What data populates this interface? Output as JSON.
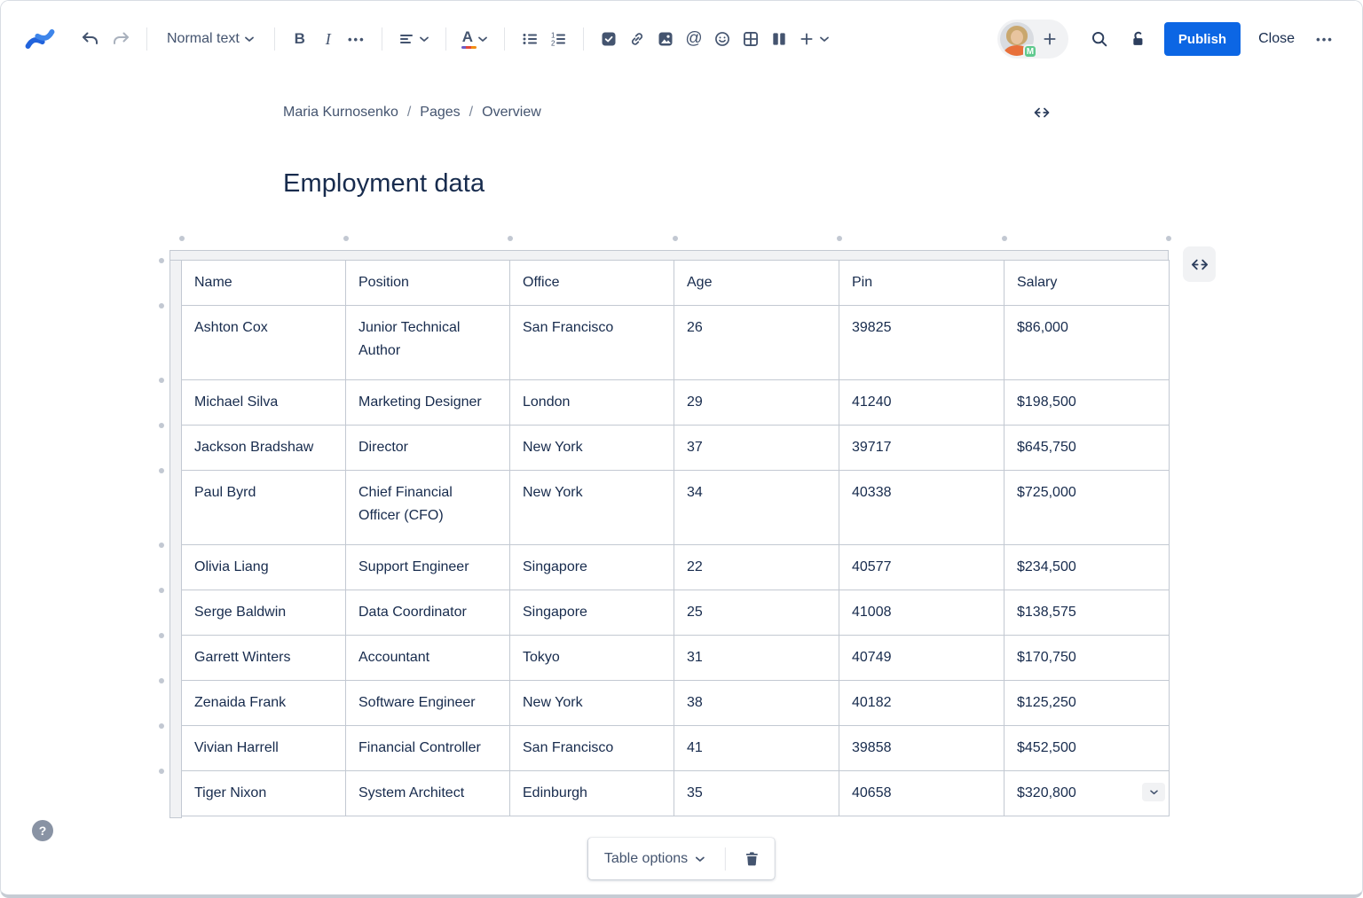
{
  "toolbar": {
    "text_style_label": "Normal text",
    "bold": "B",
    "italic": "I",
    "more": "•••",
    "color_letter": "A",
    "mention": "@",
    "ol_nums": [
      "1",
      "2"
    ],
    "publish_label": "Publish",
    "close_label": "Close",
    "actions_more": "•••",
    "avatar_badge": "M"
  },
  "breadcrumb": {
    "items": [
      "Maria Kurnosenko",
      "Pages",
      "Overview"
    ],
    "separator": "/"
  },
  "page": {
    "title": "Employment data",
    "help": "?"
  },
  "table": {
    "columns": [
      "Name",
      "Position",
      "Office",
      "Age",
      "Pin",
      "Salary"
    ],
    "rows": [
      [
        "Ashton Cox",
        "Junior Technical Author",
        "San Francisco",
        "26",
        "39825",
        "$86,000"
      ],
      [
        "Michael Silva",
        "Marketing Designer",
        "London",
        "29",
        "41240",
        "$198,500"
      ],
      [
        "Jackson Bradshaw",
        "Director",
        "New York",
        "37",
        "39717",
        "$645,750"
      ],
      [
        "Paul Byrd",
        "Chief Financial Officer (CFO)",
        "New York",
        "34",
        "40338",
        "$725,000"
      ],
      [
        "Olivia Liang",
        "Support Engineer",
        "Singapore",
        "22",
        "40577",
        "$234,500"
      ],
      [
        "Serge Baldwin",
        "Data Coordinator",
        "Singapore",
        "25",
        "41008",
        "$138,575"
      ],
      [
        "Garrett Winters",
        "Accountant",
        "Tokyo",
        "31",
        "40749",
        "$170,750"
      ],
      [
        "Zenaida Frank",
        "Software Engineer",
        "New York",
        "38",
        "40182",
        "$125,250"
      ],
      [
        "Vivian Harrell",
        "Financial Controller",
        "San Francisco",
        "41",
        "39858",
        "$452,500"
      ],
      [
        "Tiger Nixon",
        "System Architect",
        "Edinburgh",
        "35",
        "40658",
        "$320,800"
      ]
    ]
  },
  "table_toolbar": {
    "options_label": "Table options"
  },
  "colors": {
    "publish_blue": "#0C66E4",
    "text_dark": "#172B4D",
    "toolbar_icon": "#44546F",
    "table_border": "#C3C9D2",
    "strip_bg": "#F1F2F4",
    "badge_green": "#5FC98E",
    "color_swatches": [
      "#6E5DC6",
      "#E2483D",
      "#F18D13"
    ]
  }
}
